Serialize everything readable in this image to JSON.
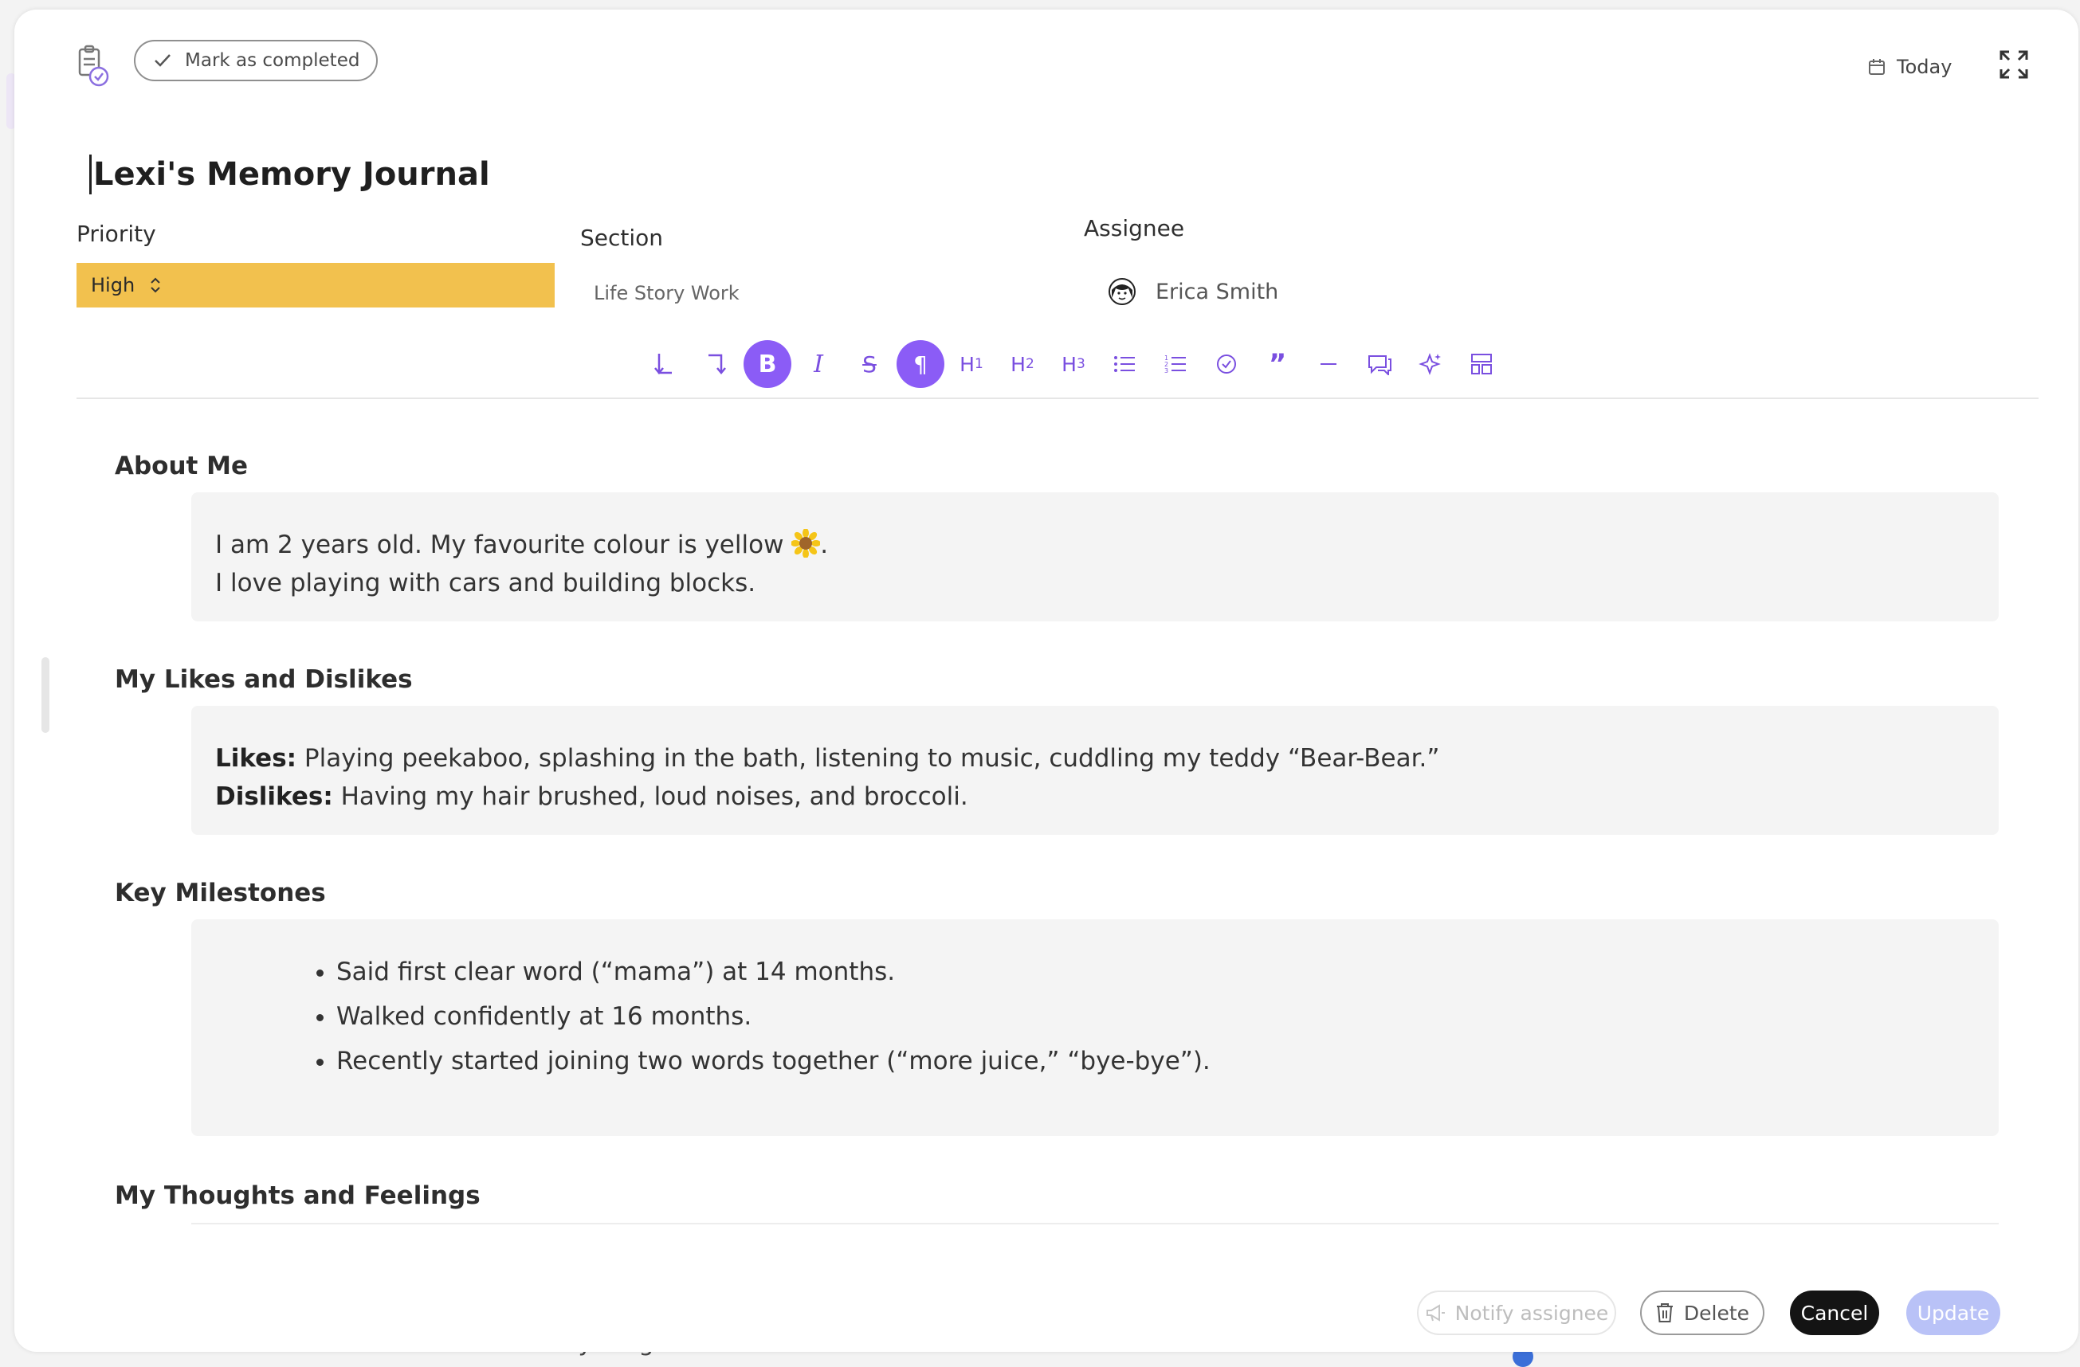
{
  "header": {
    "complete_label": "Mark as completed",
    "date_label": "Today"
  },
  "task": {
    "title": "Lexi's Memory Journal"
  },
  "fields": {
    "priority_label": "Priority",
    "priority_value": "High",
    "section_label": "Section",
    "section_value": "Life Story Work",
    "assignee_label": "Assignee",
    "assignee_value": "Erica Smith"
  },
  "toolbar": {
    "buttons": [
      "undo-icon",
      "redo-icon",
      "bold-icon",
      "italic-icon",
      "strikethrough-icon",
      "paragraph-icon",
      "heading-1-icon",
      "heading-2-icon",
      "heading-3-icon",
      "bullet-list-icon",
      "numbered-list-icon",
      "task-list-icon",
      "quote-icon",
      "horizontal-rule-icon",
      "comment-icon",
      "ai-sparkle-icon",
      "layout-icon"
    ],
    "active": [
      "bold-icon",
      "paragraph-icon"
    ],
    "accent_color": "#8b5cf6"
  },
  "content": {
    "about": {
      "heading": "About Me",
      "line1": "I am 2 years old. My favourite colour is yellow",
      "line1_end": ".",
      "line2": "I love playing with cars and building blocks."
    },
    "likes": {
      "heading": "My Likes and Dislikes",
      "likes_label": "Likes:",
      "likes_text": " Playing peekaboo, splashing in the bath, listening to music, cuddling my teddy “Bear-Bear.”",
      "dislikes_label": "Dislikes:",
      "dislikes_text": " Having my hair brushed, loud noises, and broccoli."
    },
    "milestones": {
      "heading": "Key Milestones",
      "items": [
        "Said first clear word (“mama”) at 14 months.",
        "Walked confidently at 16 months.",
        "Recently started joining two words together (“more juice,” “bye-bye”)."
      ]
    },
    "thoughts": {
      "heading": "My Thoughts and Feelings"
    }
  },
  "footer": {
    "notify_label": "Notify assignee",
    "delete_label": "Delete",
    "cancel_label": "Cancel",
    "update_label": "Update"
  },
  "background": {
    "partial_text": "Ask anything"
  },
  "colors": {
    "priority_high": "#f2c14e",
    "update_disabled": "#b9c2f7",
    "cancel": "#141414"
  }
}
